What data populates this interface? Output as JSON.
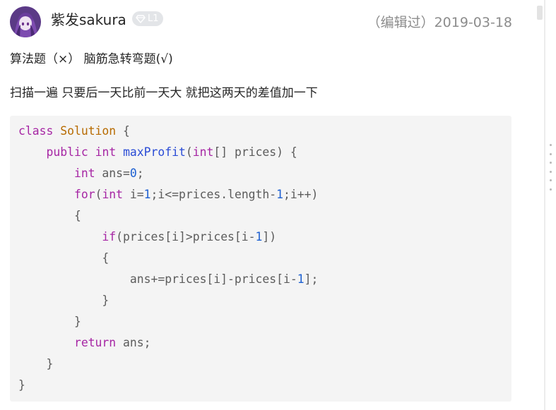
{
  "post": {
    "author": {
      "name": "紫发sakura",
      "level": "L1"
    },
    "edited_date": "（编辑过）2019-03-18",
    "paragraphs": [
      "算法题（×） 脑筋急转弯题(√)",
      "扫描一遍 只要后一天比前一天大 就把这两天的差值加一下"
    ]
  },
  "code": {
    "language": "java",
    "lines": [
      [
        [
          "kw",
          "class"
        ],
        [
          "plain",
          " "
        ],
        [
          "class",
          "Solution"
        ],
        [
          "plain",
          " {"
        ]
      ],
      [
        [
          "plain",
          "    "
        ],
        [
          "kw",
          "public"
        ],
        [
          "plain",
          " "
        ],
        [
          "type",
          "int"
        ],
        [
          "plain",
          " "
        ],
        [
          "title",
          "maxProfit"
        ],
        [
          "plain",
          "("
        ],
        [
          "type",
          "int"
        ],
        [
          "plain",
          "[] prices) {"
        ]
      ],
      [
        [
          "plain",
          "        "
        ],
        [
          "type",
          "int"
        ],
        [
          "plain",
          " ans="
        ],
        [
          "num",
          "0"
        ],
        [
          "plain",
          ";"
        ]
      ],
      [
        [
          "plain",
          "        "
        ],
        [
          "kw",
          "for"
        ],
        [
          "plain",
          "("
        ],
        [
          "type",
          "int"
        ],
        [
          "plain",
          " i="
        ],
        [
          "num",
          "1"
        ],
        [
          "plain",
          ";i<=prices.length-"
        ],
        [
          "num",
          "1"
        ],
        [
          "plain",
          ";i++)"
        ]
      ],
      [
        [
          "plain",
          "        {"
        ]
      ],
      [
        [
          "plain",
          "            "
        ],
        [
          "kw",
          "if"
        ],
        [
          "plain",
          "(prices[i]>prices[i-"
        ],
        [
          "num",
          "1"
        ],
        [
          "plain",
          "])"
        ]
      ],
      [
        [
          "plain",
          "            {"
        ]
      ],
      [
        [
          "plain",
          "                ans+=prices[i]-prices[i-"
        ],
        [
          "num",
          "1"
        ],
        [
          "plain",
          "];"
        ]
      ],
      [
        [
          "plain",
          "            }"
        ]
      ],
      [
        [
          "plain",
          "        }"
        ]
      ],
      [
        [
          "plain",
          "        "
        ],
        [
          "kw",
          "return"
        ],
        [
          "plain",
          " ans;"
        ]
      ],
      [
        [
          "plain",
          "    }"
        ]
      ],
      [
        [
          "plain",
          "}"
        ]
      ]
    ]
  },
  "colors": {
    "keyword": "#a626a4",
    "function_name": "#2a4cd6",
    "number": "#1c5fd1",
    "class_name": "#b76b01",
    "code_background": "#f4f4f4",
    "meta_text": "#8c8c8c"
  },
  "icons": {
    "level_badge": "diamond-icon",
    "drag_handle": "vertical-dots-icon"
  }
}
